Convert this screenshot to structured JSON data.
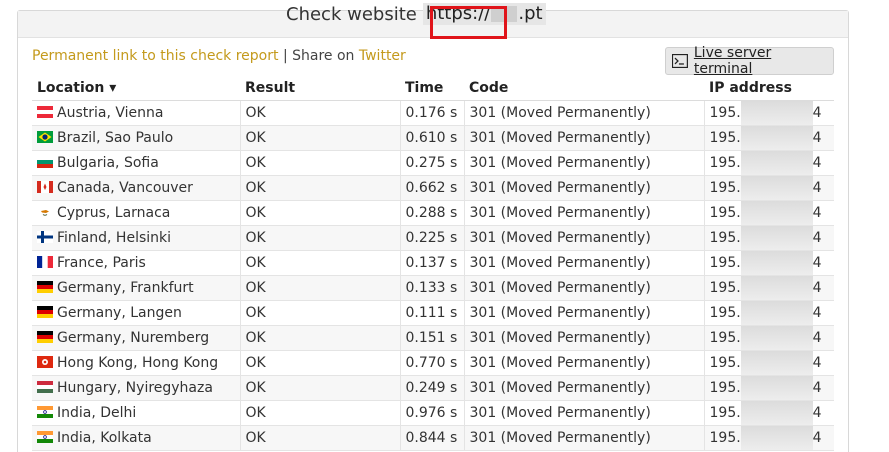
{
  "header": {
    "title_prefix": "Check website",
    "url_scheme": "https://",
    "url_suffix": ".pt"
  },
  "links": {
    "permalink": "Permanent link to this check report",
    "separator": "|",
    "share_prefix": "Share on",
    "share_target": "Twitter"
  },
  "terminal_button": {
    "label": "Live server terminal",
    "icon": "terminal-icon"
  },
  "table": {
    "columns": [
      "Location ▾",
      "Result",
      "Time",
      "Code",
      "IP address"
    ],
    "rows": [
      {
        "flag": "at",
        "location": "Austria, Vienna",
        "result": "OK",
        "time": "0.176 s",
        "code": "301 (Moved Permanently)",
        "ip_start": "195.",
        "ip_end": "4"
      },
      {
        "flag": "br",
        "location": "Brazil, Sao Paulo",
        "result": "OK",
        "time": "0.610 s",
        "code": "301 (Moved Permanently)",
        "ip_start": "195.",
        "ip_end": "4"
      },
      {
        "flag": "bg",
        "location": "Bulgaria, Sofia",
        "result": "OK",
        "time": "0.275 s",
        "code": "301 (Moved Permanently)",
        "ip_start": "195.",
        "ip_end": "4"
      },
      {
        "flag": "ca",
        "location": "Canada, Vancouver",
        "result": "OK",
        "time": "0.662 s",
        "code": "301 (Moved Permanently)",
        "ip_start": "195.",
        "ip_end": "4"
      },
      {
        "flag": "cy",
        "location": "Cyprus, Larnaca",
        "result": "OK",
        "time": "0.288 s",
        "code": "301 (Moved Permanently)",
        "ip_start": "195.",
        "ip_end": "4"
      },
      {
        "flag": "fi",
        "location": "Finland, Helsinki",
        "result": "OK",
        "time": "0.225 s",
        "code": "301 (Moved Permanently)",
        "ip_start": "195.",
        "ip_end": "4"
      },
      {
        "flag": "fr",
        "location": "France, Paris",
        "result": "OK",
        "time": "0.137 s",
        "code": "301 (Moved Permanently)",
        "ip_start": "195.",
        "ip_end": "4"
      },
      {
        "flag": "de",
        "location": "Germany, Frankfurt",
        "result": "OK",
        "time": "0.133 s",
        "code": "301 (Moved Permanently)",
        "ip_start": "195.",
        "ip_end": "4"
      },
      {
        "flag": "de",
        "location": "Germany, Langen",
        "result": "OK",
        "time": "0.111 s",
        "code": "301 (Moved Permanently)",
        "ip_start": "195.",
        "ip_end": "4"
      },
      {
        "flag": "de",
        "location": "Germany, Nuremberg",
        "result": "OK",
        "time": "0.151 s",
        "code": "301 (Moved Permanently)",
        "ip_start": "195.",
        "ip_end": "4"
      },
      {
        "flag": "hk",
        "location": "Hong Kong, Hong Kong",
        "result": "OK",
        "time": "0.770 s",
        "code": "301 (Moved Permanently)",
        "ip_start": "195.",
        "ip_end": "4"
      },
      {
        "flag": "hu",
        "location": "Hungary, Nyiregyhaza",
        "result": "OK",
        "time": "0.249 s",
        "code": "301 (Moved Permanently)",
        "ip_start": "195.",
        "ip_end": "4"
      },
      {
        "flag": "in",
        "location": "India, Delhi",
        "result": "OK",
        "time": "0.976 s",
        "code": "301 (Moved Permanently)",
        "ip_start": "195.",
        "ip_end": "4"
      },
      {
        "flag": "in",
        "location": "India, Kolkata",
        "result": "OK",
        "time": "0.844 s",
        "code": "301 (Moved Permanently)",
        "ip_start": "195.",
        "ip_end": "4"
      }
    ]
  },
  "colors": {
    "link": "#c49a1c",
    "highlight_border": "#e0141a",
    "header_bg": "#f3f3f3"
  }
}
